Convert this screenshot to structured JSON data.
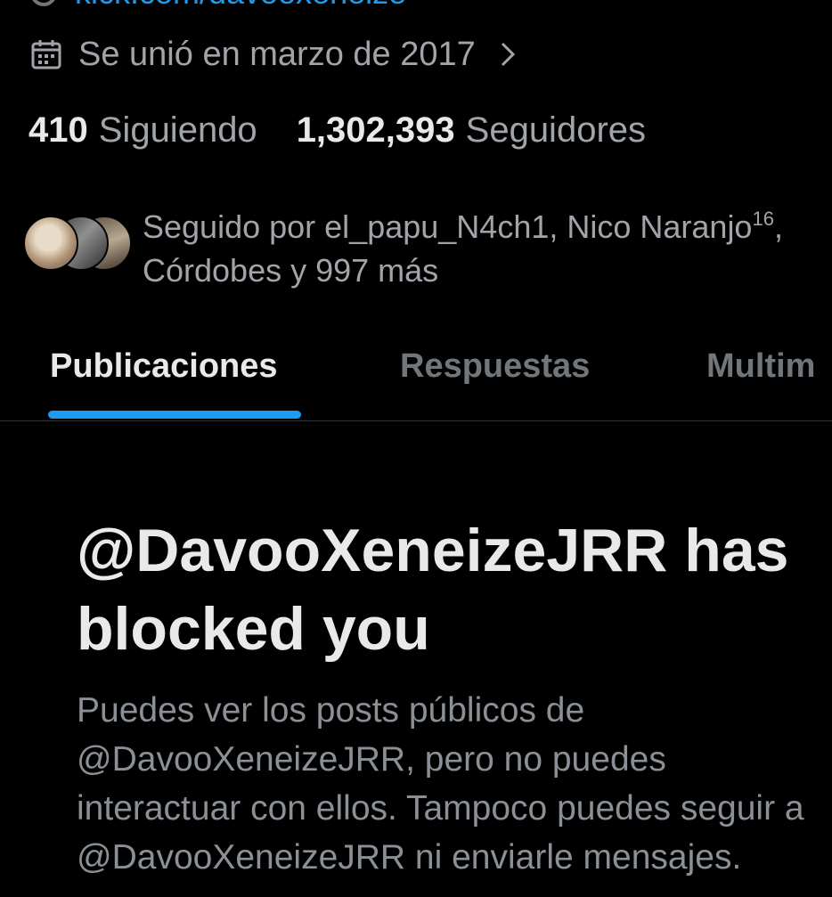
{
  "profile": {
    "website_partial": "kick.com/davooxeneize",
    "joined_text": "Se unió en marzo de 2017",
    "following_count": "410",
    "following_label": "Siguiendo",
    "followers_count": "1,302,393",
    "followers_label": "Seguidores",
    "followed_by": {
      "prefix": "Seguido por el_papu_N4ch1, Nico Naranjo",
      "sup": "16",
      "suffix": ",",
      "line2": "Córdobes y 997 más"
    }
  },
  "tabs": [
    {
      "label": "Publicaciones",
      "active": true
    },
    {
      "label": "Respuestas",
      "active": false
    },
    {
      "label": "Multim",
      "active": false
    }
  ],
  "blocked": {
    "title": "@DavooXeneizeJRR has\nblocked you",
    "body": "Puedes ver los posts públicos de\n@DavooXeneizeJRR, pero no puedes\ninteractuar con ellos. Tampoco puedes seguir a\n@DavooXeneizeJRR ni enviarle mensajes."
  },
  "colors": {
    "background": "#000000",
    "primary_text": "#e7e9ea",
    "secondary_text": "#71767b",
    "accent": "#1d9bf0",
    "divider": "#2f3336"
  },
  "icons": [
    "link-icon",
    "calendar-icon",
    "chevron-right-icon"
  ]
}
